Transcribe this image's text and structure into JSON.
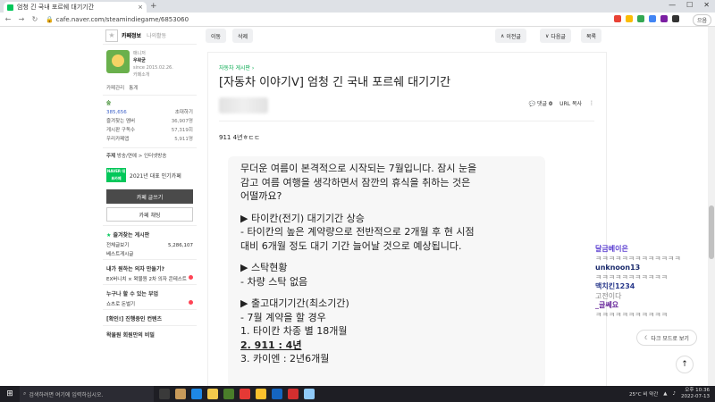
{
  "browser": {
    "tab_title": "엄청 긴 국내 포르쉐 대기기간",
    "tab_close": "×",
    "new_tab": "+",
    "url": "cafe.naver.com/steamindiegame/6853060",
    "profile_label": "으음"
  },
  "toolbar": {
    "move": "이동",
    "delete": "삭제",
    "prev": "이전글",
    "next": "다음글",
    "list": "목록"
  },
  "sidebar": {
    "tab_info": "카페정보",
    "tab_activity": "나의활동",
    "manager_label": "매니저",
    "manager_name": "우왁굳",
    "since": "since 2015.02.26.",
    "cafe_intro": "카페소개",
    "link_manage": "카페관리",
    "link_stats": "통계",
    "level": "숲",
    "members": "385,656",
    "invite": "초대하기",
    "fav_members": "즐겨찾는 멤버",
    "fav_members_count": "36,907명",
    "board_subs": "게시판 구독수",
    "board_subs_count": "57,319회",
    "cafe_app": "우리카페앱",
    "cafe_app_count": "5,911명",
    "topic": "주제",
    "topic_value": "방송/연예 > 인터넷방송",
    "naver_badge": "NAVER 대표카페",
    "naver_award": "2021년 대표 인기카페",
    "write_btn": "카페 글쓰기",
    "chat_btn": "카페 채팅",
    "fav_boards_title": "즐겨찾는 게시판",
    "all_posts": "전체글보기",
    "all_posts_count": "5,286,107",
    "best_posts": "베스트게시글",
    "menu1_title": "내가 원하는 의자 만들기?",
    "menu1_item": "EX버니치 × 왁물원 2차 의자 콘테스트",
    "menu2_title": "누구나 할 수 있는 부업",
    "menu2_item": "쇼츠로 돈벌기",
    "menu3_title": "[확인!] 진행중인 컨텐츠",
    "menu4_title": "왁물원 회원만의 비밀"
  },
  "article": {
    "category": "자동차 게시판 ›",
    "title": "[자동차 이야기ᐯ] 엄청 긴 국내 포르쉐 대기기간",
    "comments_label": "댓글",
    "comments_count": "0",
    "url_copy": "URL 복사",
    "more": "⋮",
    "subtitle": "911 4년ㅎㄷㄷ",
    "lines": [
      "무더운 여름이 본격적으로 시작되는 7월입니다. 잠시 눈을",
      "감고 여름 여행을 생각하면서 잠깐의 휴식을 취하는 것은",
      "어떨까요?",
      "",
      "▶ 타이칸(전기) 대기기간 상승",
      "- 타이칸의 높은 계약량으로 전반적으로 2개월 후 현 시점",
      "대비 6개월 정도 대기 기간 늘어날 것으로 예상됩니다.",
      "",
      "▶ 스탁현황",
      "- 차량 스탁 없음",
      "",
      "▶ 출고대기기간(최소기간)",
      "- 7월 계약을 할 경우",
      "1. 타이칸 차종 별 18개월",
      "2. 911 : 4년",
      "3. 카이엔 : 2년6개월"
    ]
  },
  "chat": {
    "messages": [
      {
        "text": "달금베이은",
        "color": "#5b3fd1"
      },
      {
        "text": "ㅋㅋㅋㅋㅋㅋㅋㅋㅋㅋㅋㅋㅋ",
        "color": "#888888"
      },
      {
        "text": "unknoon13",
        "color": "#1a2a6c"
      },
      {
        "text": "ㅋㅋㅋㅋㅋㅋㅋㅋㅋㅋㅋ",
        "color": "#888888"
      },
      {
        "text": "맥치킨1234",
        "color": "#2a3a8c"
      },
      {
        "text": "고전이다",
        "color": "#888888"
      },
      {
        "text": "_글쎄요",
        "color": "#6a2a9c"
      },
      {
        "text": "ㅋㅋㅋㅋㅋㅋㅋㅋㅋㅋㅋ",
        "color": "#888888"
      }
    ]
  },
  "floating": {
    "dark_mode": "다크 모드로 보기",
    "top": "↑"
  },
  "taskbar": {
    "search_placeholder": "검색하려면 여기에 입력하십시오.",
    "weather": "25°C 비 약간",
    "time": "오후 10:36",
    "date": "2022-07-13"
  },
  "colors": {
    "naver_green": "#03c75a",
    "category_green": "#03a94d"
  }
}
